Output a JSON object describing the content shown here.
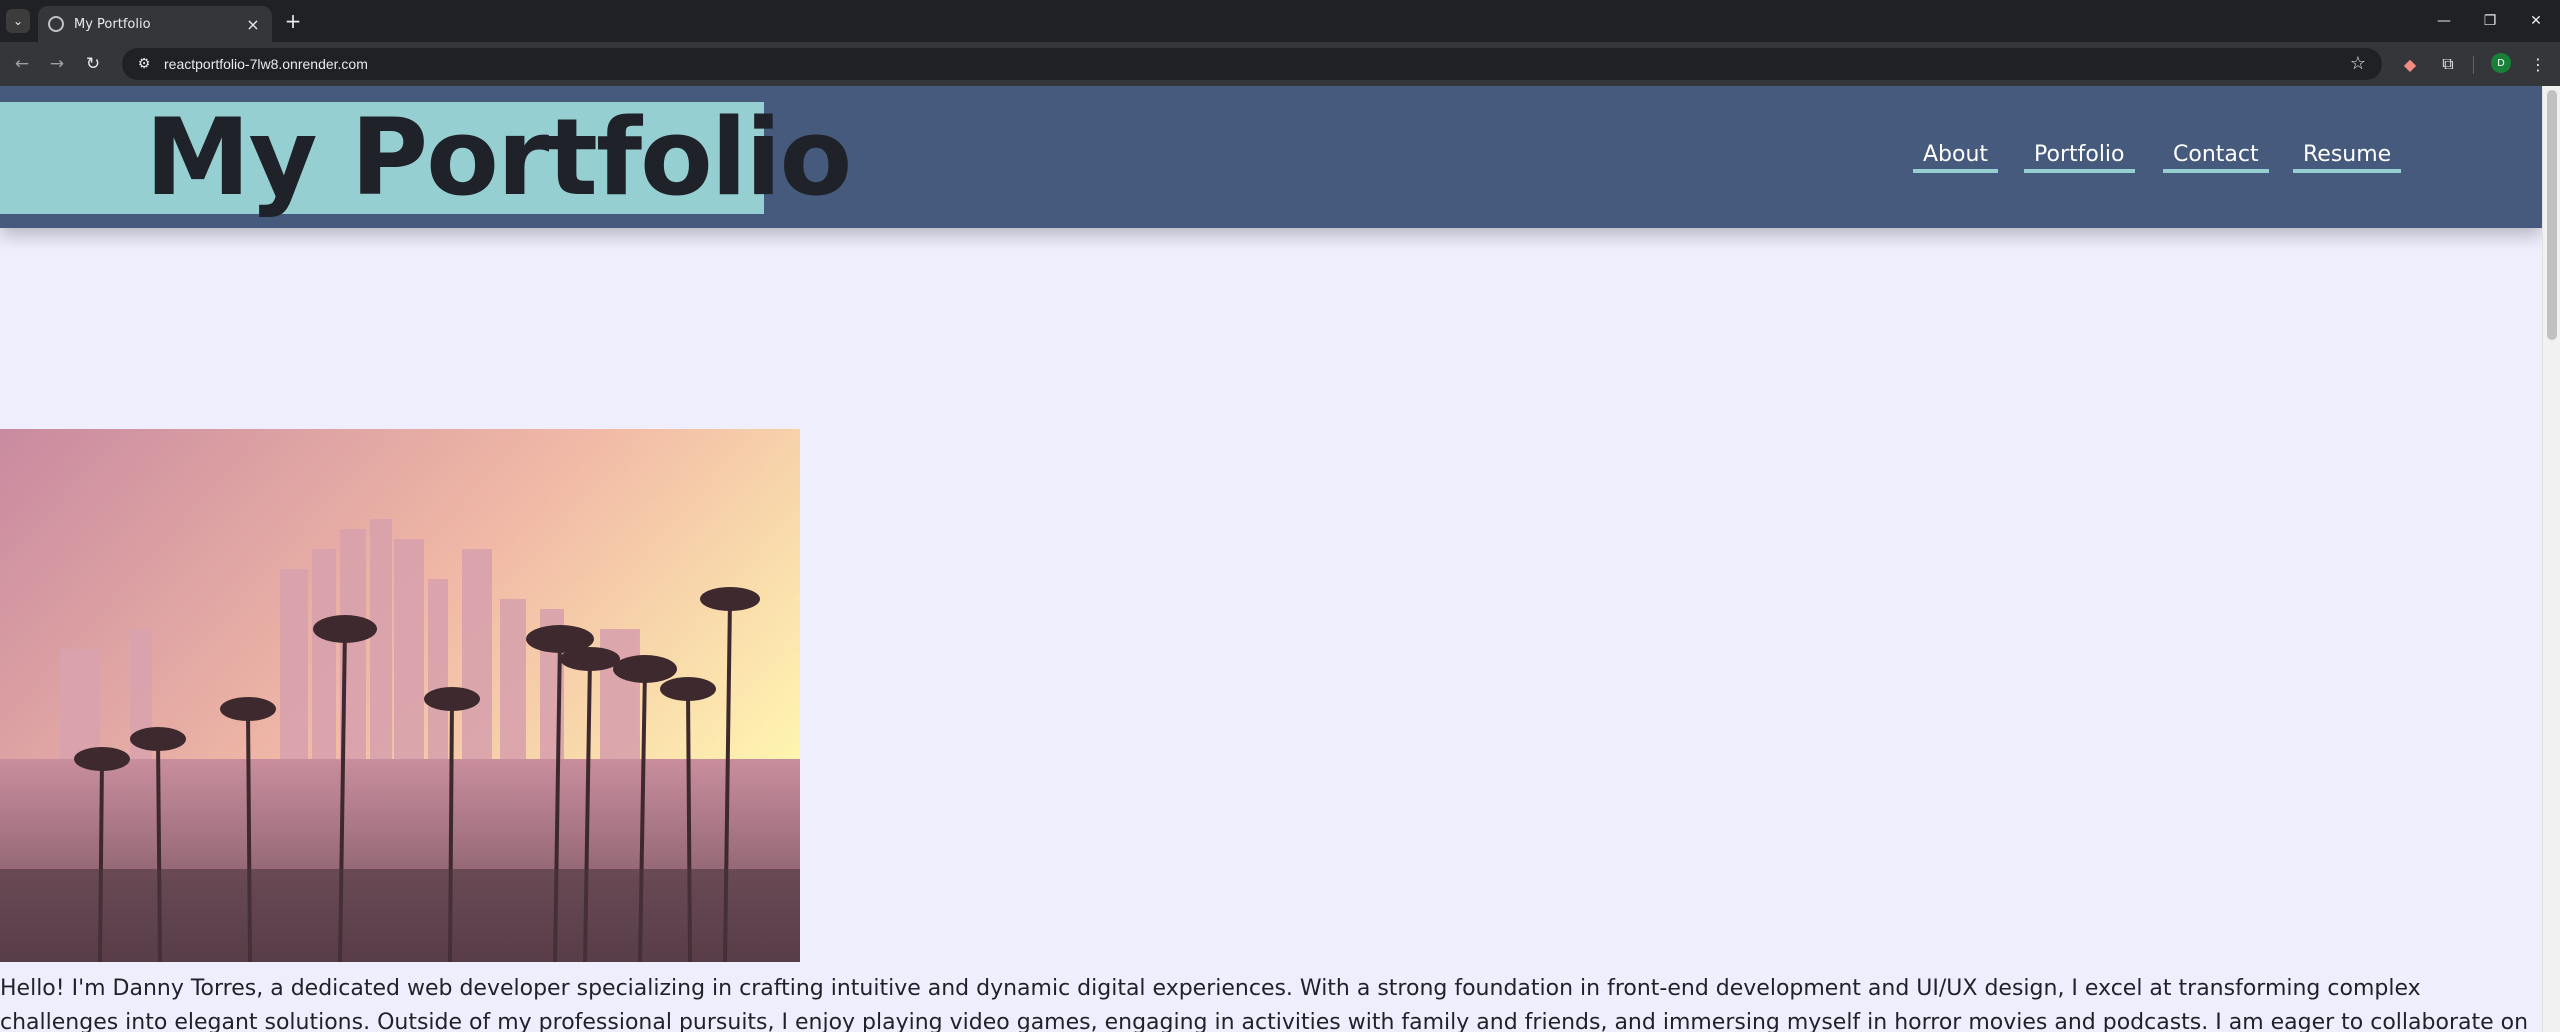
{
  "browser": {
    "tab_title": "My Portfolio",
    "url": "reactportfolio-7lw8.onrender.com",
    "new_tab_symbol": "+",
    "profile_initial": "D"
  },
  "site": {
    "logo": "My Portfolio",
    "nav": [
      {
        "label": "About"
      },
      {
        "label": "Portfolio"
      },
      {
        "label": "Contact"
      },
      {
        "label": "Resume"
      }
    ],
    "bio": "Hello! I'm Danny Torres, a dedicated web developer specializing in crafting intuitive and dynamic digital experiences. With a strong foundation in front-end development and UI/UX design, I excel at transforming complex challenges into elegant solutions. Outside of my professional pursuits, I enjoy playing video games, engaging in activities with family and friends, and immersing myself in horror movies and podcasts. I am eager to collaborate on innovative projects and drive impactful"
  },
  "colors": {
    "header_bg": "#455a7c",
    "logo_bg": "#96cfd1",
    "page_bg": "#efeefd",
    "nav_underline": "#96cfd1"
  },
  "icons": {
    "hero_image": "los-angeles-skyline-palm-trees"
  }
}
